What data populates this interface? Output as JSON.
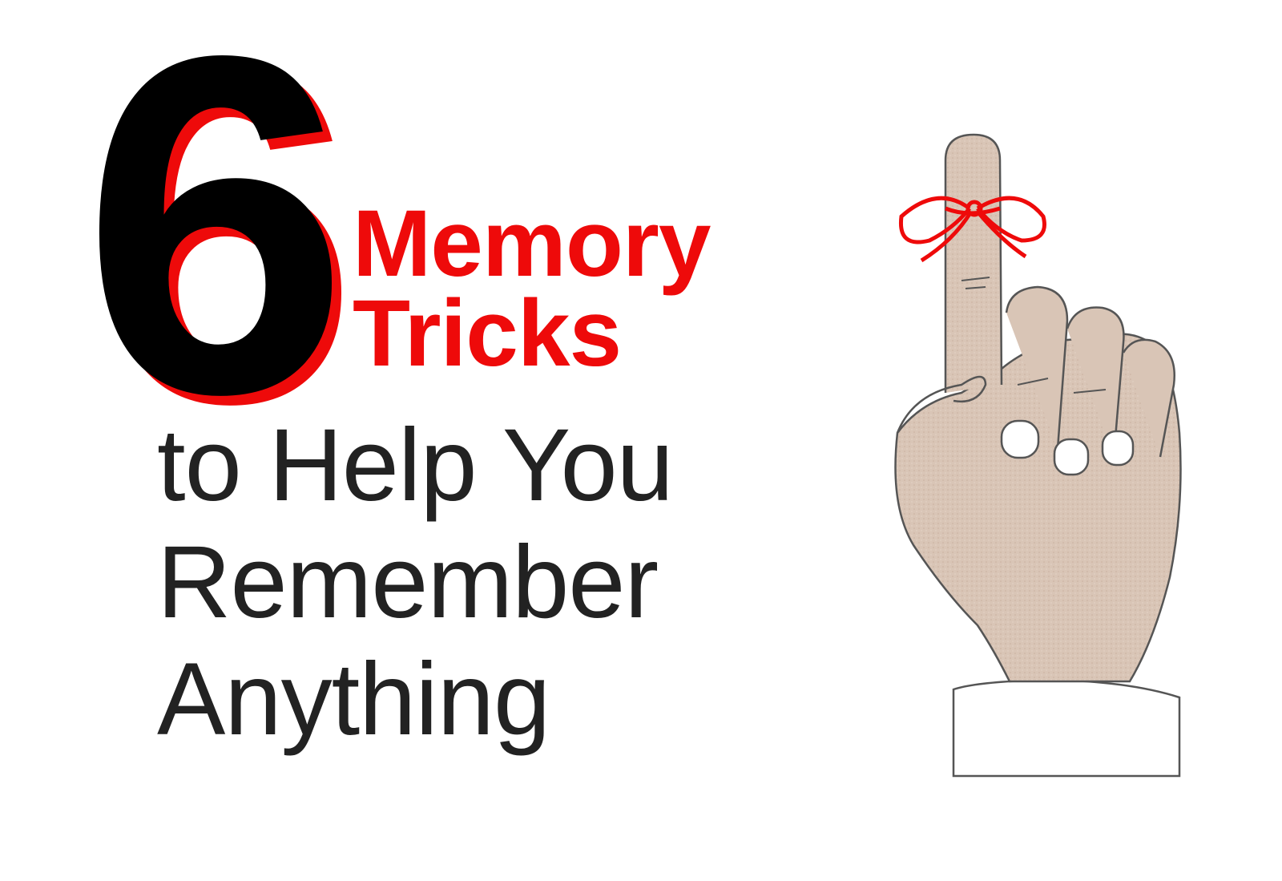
{
  "headline": {
    "number": "6",
    "red_line1": "Memory",
    "red_line2": "Tricks",
    "black_line1": "to Help You",
    "black_line2": "Remember",
    "black_line3": "Anything"
  },
  "colors": {
    "accent_red": "#ee0a0a",
    "text_black": "#222222",
    "skin": "#d9c5b6",
    "outline": "#555555"
  },
  "illustration": {
    "icon": "hand-with-string-icon"
  }
}
